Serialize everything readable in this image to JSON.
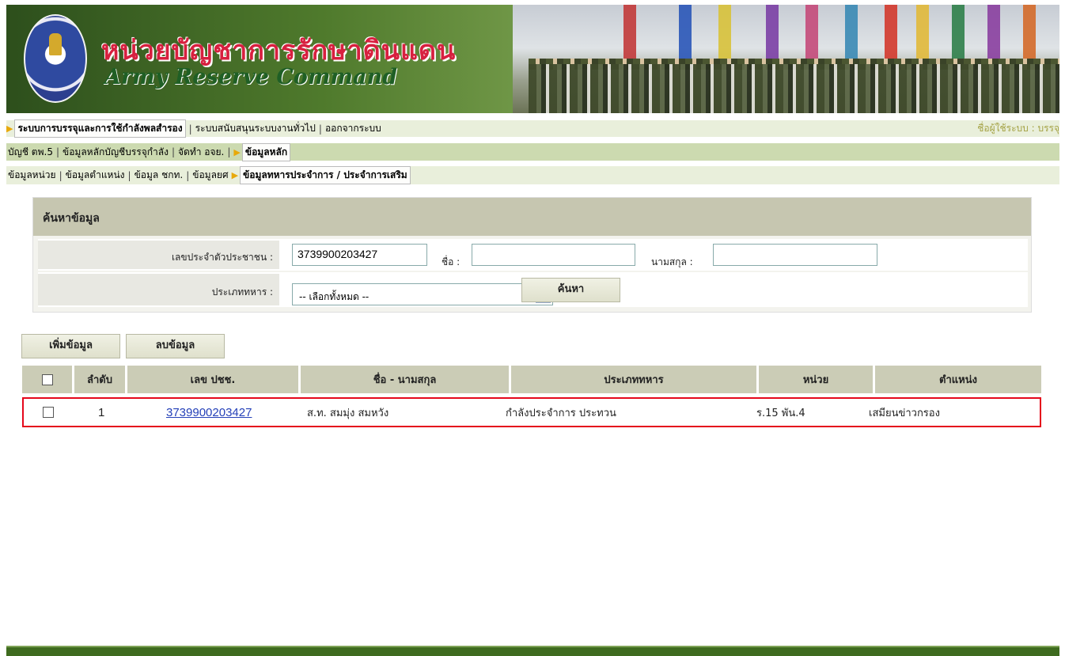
{
  "header": {
    "title_th": "หน่วยบัญชาการรักษาดินแดน",
    "title_en": "Army Reserve Command"
  },
  "menu1": {
    "items": [
      "ระบบการบรรจุและการใช้กำลังพลสำรอง",
      "ระบบสนับสนุนระบบงานทั่วไป",
      "ออกจากระบบ"
    ],
    "user_label": "ชื่อผู้ใช้ระบบ : บรรจุ"
  },
  "menu2": {
    "items": [
      "บัญชี ตพ.5",
      "ข้อมูลหลักบัญชีบรรจุกำลัง",
      "จัดทำ อจย."
    ],
    "active": "ข้อมูลหลัก"
  },
  "menu3": {
    "items": [
      "ข้อมูลหน่วย",
      "ข้อมูลตำแหน่ง",
      "ข้อมูล ชกท.",
      "ข้อมูลยศ"
    ],
    "active": "ข้อมูลทหารประจำการ / ประจำการเสริม"
  },
  "search": {
    "header": "ค้นหาข้อมูล",
    "id_label": "เลขประจำตัวประชาชน :",
    "id_value": "3739900203427",
    "name_label": "ชื่อ :",
    "name_value": "",
    "surname_label": "นามสกุล :",
    "surname_value": "",
    "type_label": "ประเภททหาร :",
    "type_selected": "-- เลือกทั้งหมด --",
    "search_button": "ค้นหา"
  },
  "actions": {
    "add_button": "เพิ่มข้อมูล",
    "delete_button": "ลบข้อมูล"
  },
  "table": {
    "columns": [
      "ลำดับ",
      "เลข ปชช.",
      "ชื่อ - นามสกุล",
      "ประเภททหาร",
      "หน่วย",
      "ตำแหน่ง"
    ],
    "rows": [
      {
        "no": "1",
        "id": "3739900203427",
        "name": "ส.ท. สมมุ่ง  สมหวัง",
        "type": "กำลังประจำการ ประทวน",
        "unit": "ร.15 พัน.4",
        "position": "เสมียนข่าวกรอง"
      }
    ]
  },
  "colors": {
    "menu_light": "#e9efdb",
    "menu_dark": "#ccdab0",
    "table_header": "#cbccb6",
    "highlight_border": "#e5071b",
    "link": "#2440b8"
  }
}
